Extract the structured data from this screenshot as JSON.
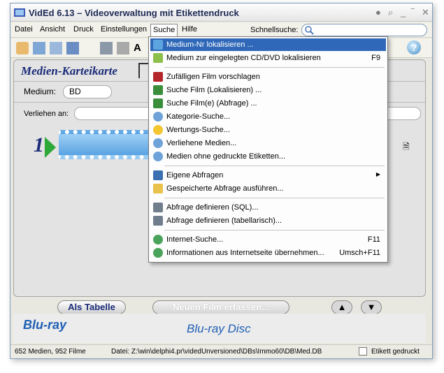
{
  "window": {
    "title": "VidEd 6.13 – Videoverwaltung mit Etikettendruck"
  },
  "menubar": {
    "items": [
      "Datei",
      "Ansicht",
      "Druck",
      "Einstellungen",
      "Suche",
      "Hilfe"
    ],
    "quicksearch_label": "Schnellsuche:",
    "quicksearch_value": ""
  },
  "card": {
    "title": "Medien-Karteikarte",
    "medium_label": "Medium:",
    "medium_value": "BD",
    "lent_label": "Verliehen an:",
    "lent_value": "",
    "number": "1"
  },
  "buttons": {
    "as_table": "Als Tabelle",
    "new_film": "Neuen Film erfassen..."
  },
  "media_type": "Blu-ray Disc",
  "logo_text": "Blu-ray",
  "status": {
    "counts": "652 Medien, 952 Filme",
    "file": "Datei: Z:\\win\\delphi4.pr\\videdUnversioned\\DBs\\Immo60\\DB\\Med.DB",
    "label_printed": "Etikett gedruckt"
  },
  "dropdown": {
    "items": [
      {
        "label": "Medium-Nr lokalisieren ...",
        "shortcut": "",
        "icon": "locate-icon",
        "color": "#5ca5e0"
      },
      {
        "label": "Medium zur eingelegten CD/DVD lokalisieren",
        "shortcut": "F9",
        "icon": "disc-icon",
        "color": "#8dbf4d"
      },
      {
        "label": "Zufälligen Film vorschlagen",
        "shortcut": "",
        "icon": "dice-icon",
        "color": "#b5262a"
      },
      {
        "label": "Suche Film (Lokalisieren) ...",
        "shortcut": "",
        "icon": "film-search-icon",
        "color": "#3a8d3a"
      },
      {
        "label": "Suche Film(e) (Abfrage) ...",
        "shortcut": "",
        "icon": "film-query-icon",
        "color": "#3a8d3a"
      },
      {
        "label": "Kategorie-Suche...",
        "shortcut": "",
        "icon": "magnifier-icon",
        "color": "#6ea2d8"
      },
      {
        "label": "Wertungs-Suche...",
        "shortcut": "",
        "icon": "star-icon",
        "color": "#f2c531"
      },
      {
        "label": "Verliehene Medien...",
        "shortcut": "",
        "icon": "magnifier-icon",
        "color": "#6ea2d8"
      },
      {
        "label": "Medien ohne gedruckte Etiketten...",
        "shortcut": "",
        "icon": "magnifier-icon",
        "color": "#6ea2d8"
      },
      {
        "label": "Eigene Abfragen",
        "shortcut": "",
        "icon": "query-icon",
        "color": "#3a6fb0"
      },
      {
        "label": "Gespeicherte Abfrage ausführen...",
        "shortcut": "",
        "icon": "folder-icon",
        "color": "#e8c24a"
      },
      {
        "label": "Abfrage definieren (SQL)...",
        "shortcut": "",
        "icon": "sql-doc-icon",
        "color": "#6f7d8c"
      },
      {
        "label": "Abfrage definieren (tabellarisch)...",
        "shortcut": "",
        "icon": "table-doc-icon",
        "color": "#6f7d8c"
      },
      {
        "label": "Internet-Suche...",
        "shortcut": "F11",
        "icon": "globe-icon",
        "color": "#4aa35b"
      },
      {
        "label": "Informationen aus Internetseite übernehmen...",
        "shortcut": "Umsch+F11",
        "icon": "globe-icon",
        "color": "#4aa35b"
      }
    ]
  }
}
